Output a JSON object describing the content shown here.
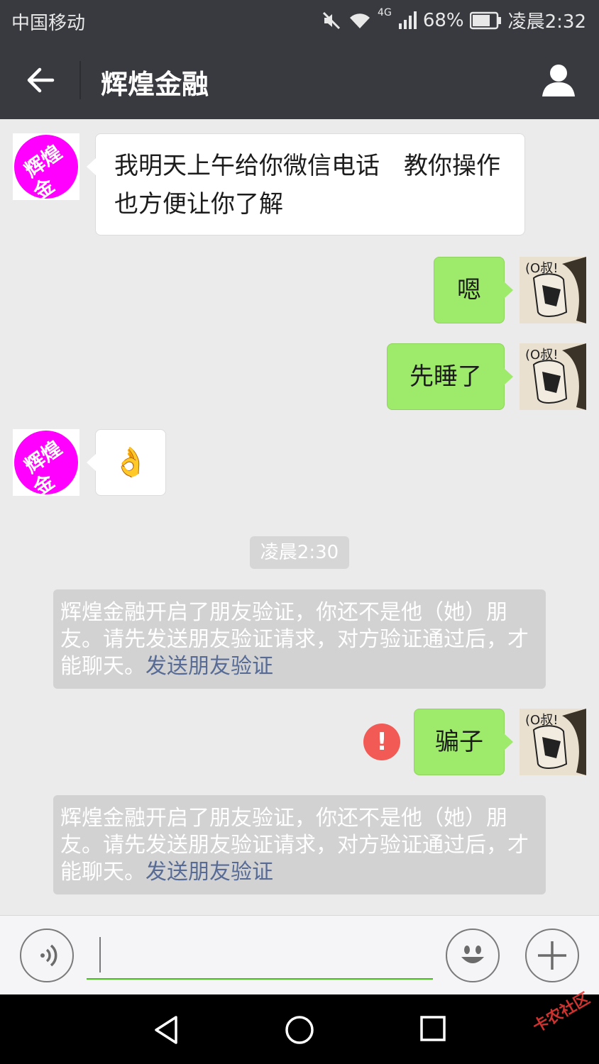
{
  "status_bar": {
    "carrier": "中国移动",
    "network": "4G",
    "battery": "68%",
    "time": "凌晨2:32"
  },
  "nav": {
    "title": "辉煌金融"
  },
  "contact_avatar_text": [
    "辉煌",
    "金融"
  ],
  "messages": [
    {
      "side": "in",
      "text": "我明天上午给你微信电话　教你操作也方便让你了解"
    },
    {
      "side": "out",
      "text": "嗯"
    },
    {
      "side": "out",
      "text": "先睡了"
    },
    {
      "side": "in",
      "text": "👌"
    }
  ],
  "timestamp": "凌晨2:30",
  "system_notices": [
    {
      "text": "辉煌金融开启了朋友验证，你还不是他（她）朋友。请先发送朋友验证请求，对方验证通过后，才能聊天。",
      "link": "发送朋友验证"
    },
    {
      "text": "辉煌金融开启了朋友验证，你还不是他（她）朋友。请先发送朋友验证请求，对方验证通过后，才能聊天。",
      "link": "发送朋友验证"
    }
  ],
  "failed_message": {
    "side": "out",
    "text": "骗子",
    "error_mark": "!"
  },
  "watermark": "卡农社区",
  "colors": {
    "header_bg": "#393a3f",
    "outgoing_bubble": "#9eea6a",
    "incoming_bubble": "#ffffff",
    "link": "#576b95",
    "error": "#f25a55",
    "input_underline": "#45c01a"
  }
}
